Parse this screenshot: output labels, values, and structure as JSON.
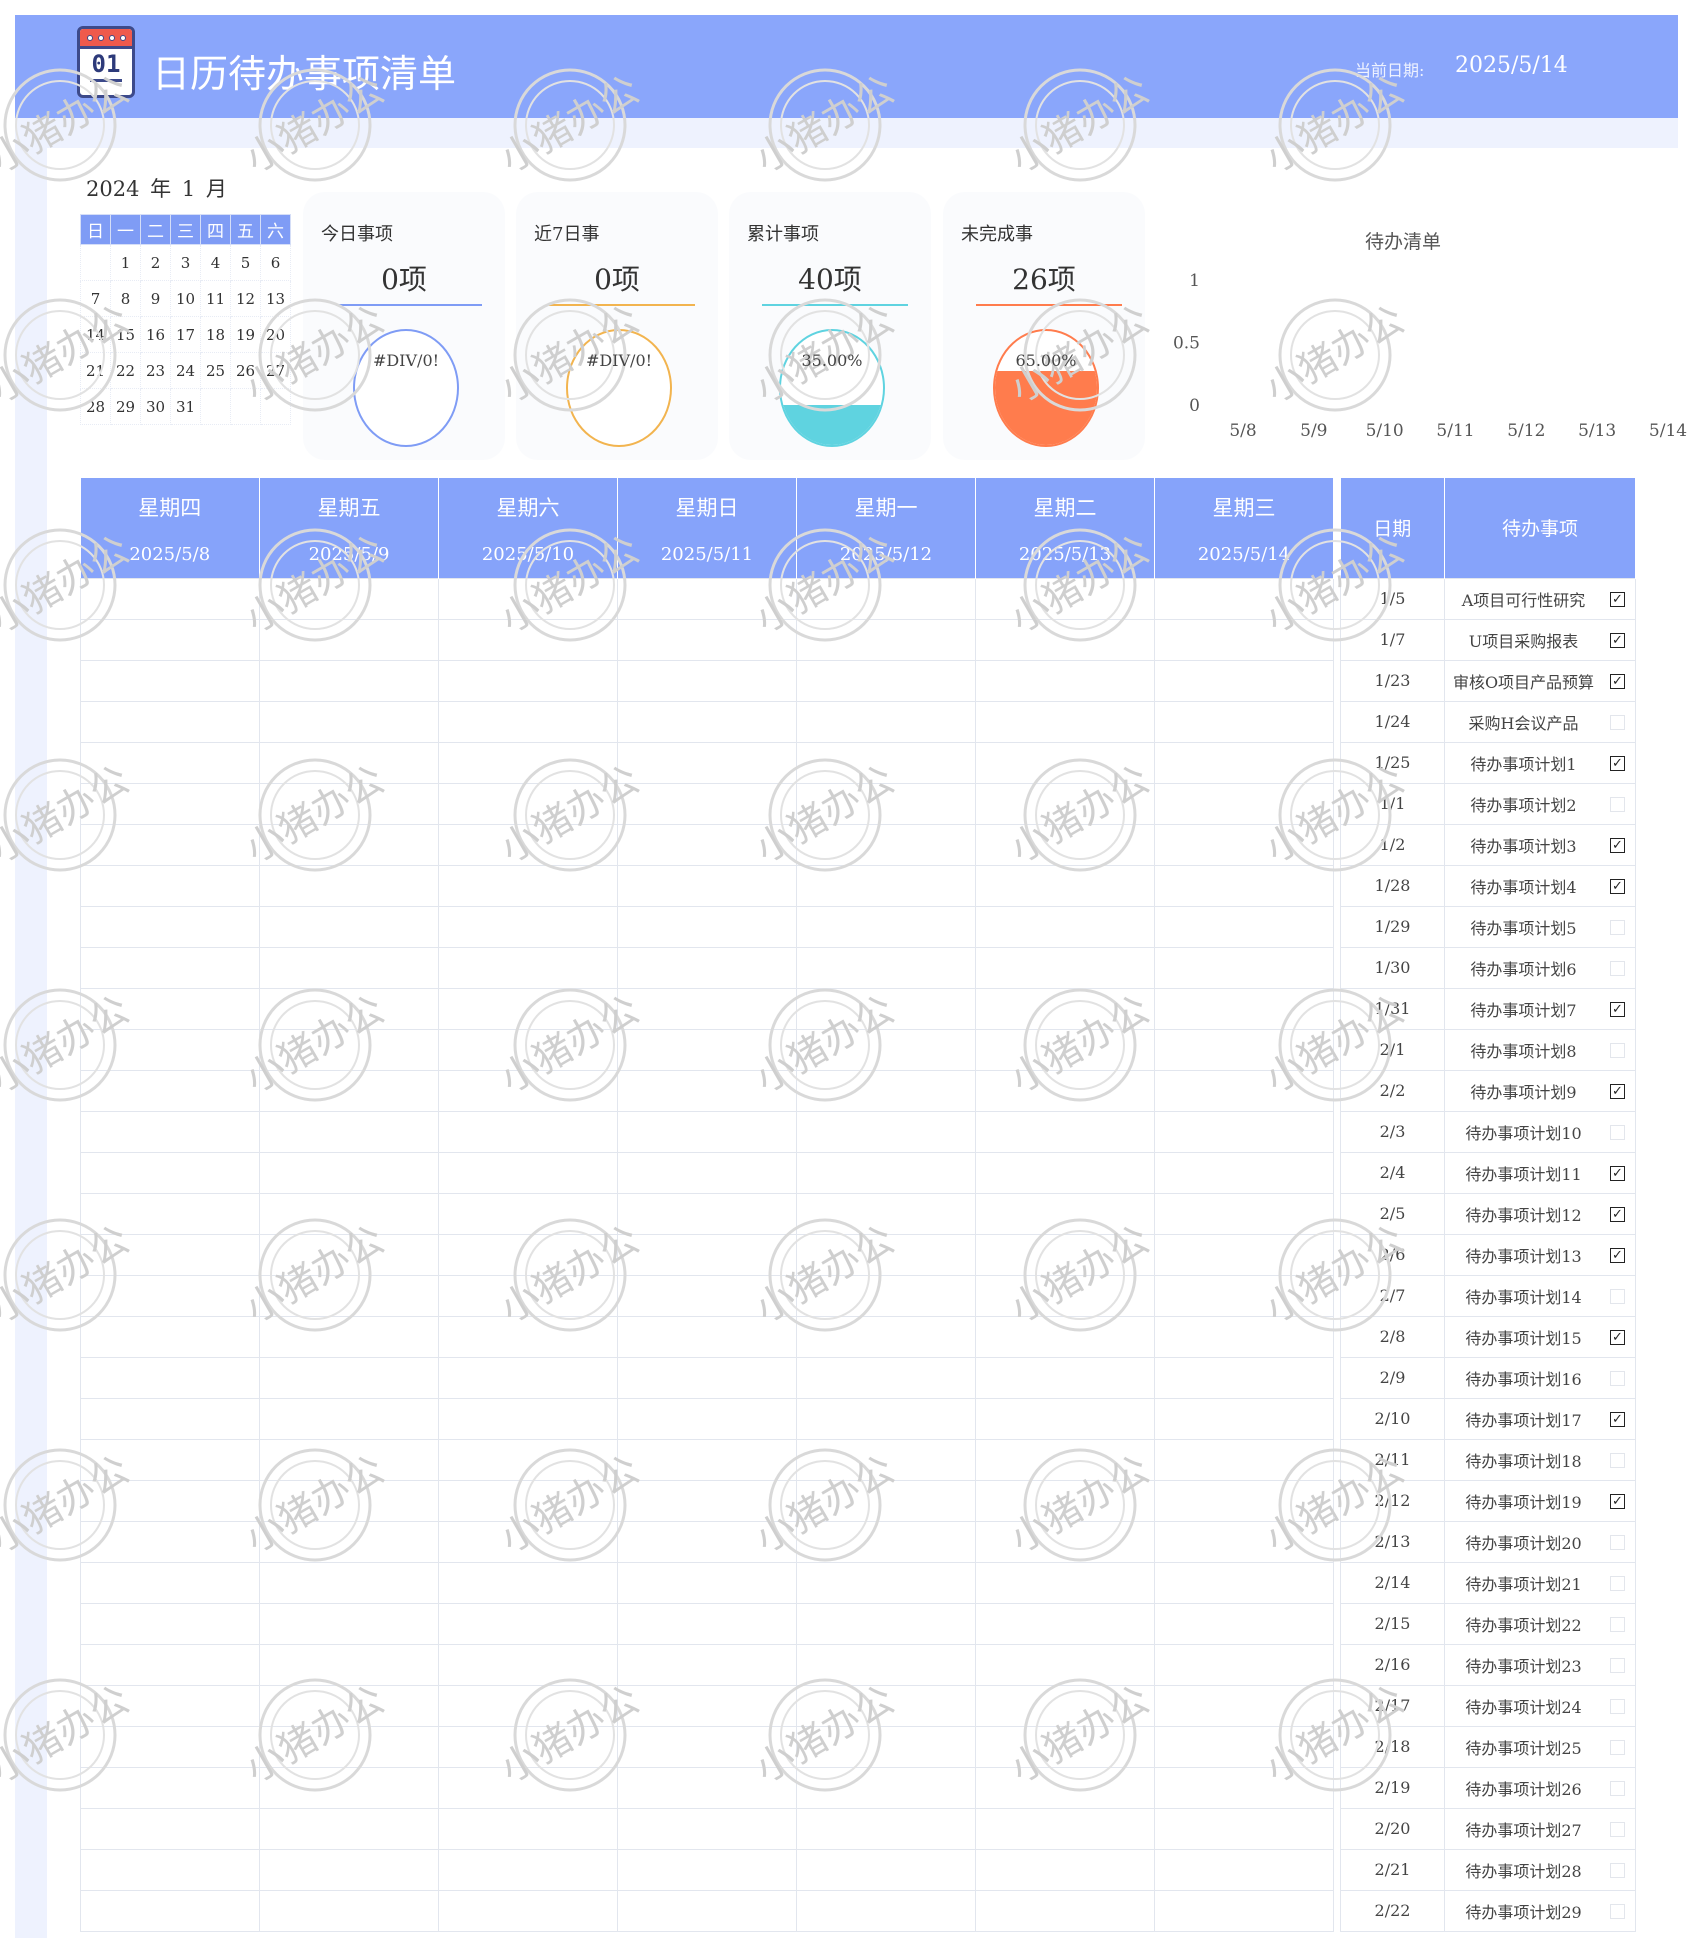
{
  "header": {
    "icon_day": "01",
    "title": "日历待办事项清单",
    "current_date_label": "当前日期:",
    "current_date": "2025/5/14",
    "brand_color": "#8aa6fb"
  },
  "mini_calendar": {
    "year": "2024",
    "year_unit": "年",
    "month": "1",
    "month_unit": "月",
    "weekdays": [
      "日",
      "一",
      "二",
      "三",
      "四",
      "五",
      "六"
    ],
    "weeks": [
      [
        "",
        "1",
        "2",
        "3",
        "4",
        "5",
        "6"
      ],
      [
        "7",
        "8",
        "9",
        "10",
        "11",
        "12",
        "13"
      ],
      [
        "14",
        "15",
        "16",
        "17",
        "18",
        "19",
        "20"
      ],
      [
        "21",
        "22",
        "23",
        "24",
        "25",
        "26",
        "27"
      ],
      [
        "28",
        "29",
        "30",
        "31",
        "",
        "",
        ""
      ]
    ]
  },
  "stats": [
    {
      "label": "今日事项",
      "value": "0项",
      "percent_text": "#DIV/0!",
      "fill": 0,
      "color": "#7f9cf5"
    },
    {
      "label": "近7日事",
      "value": "0项",
      "percent_text": "#DIV/0!",
      "fill": 0,
      "color": "#f2b44f"
    },
    {
      "label": "累计事项",
      "value": "40项",
      "percent_text": "35.00%",
      "fill": 0.35,
      "color": "#5fd3e0"
    },
    {
      "label": "未完成事",
      "value": "26项",
      "percent_text": "65.00%",
      "fill": 0.65,
      "color": "#ff7c4d"
    }
  ],
  "chart_data": {
    "type": "bar",
    "title": "待办清单",
    "categories": [
      "5/8",
      "5/9",
      "5/10",
      "5/11",
      "5/12",
      "5/13",
      "5/14"
    ],
    "values": [
      0,
      0,
      0,
      0,
      0,
      0,
      0
    ],
    "y_ticks": [
      "1",
      "0.5",
      "0"
    ],
    "ylim": [
      0,
      1
    ],
    "grid": false
  },
  "week_table": {
    "columns": [
      {
        "weekday": "星期四",
        "date": "2025/5/8"
      },
      {
        "weekday": "星期五",
        "date": "2025/5/9"
      },
      {
        "weekday": "星期六",
        "date": "2025/5/10"
      },
      {
        "weekday": "星期日",
        "date": "2025/5/11"
      },
      {
        "weekday": "星期一",
        "date": "2025/5/12"
      },
      {
        "weekday": "星期二",
        "date": "2025/5/13"
      },
      {
        "weekday": "星期三",
        "date": "2025/5/14"
      }
    ]
  },
  "todo_table": {
    "headers": {
      "date": "日期",
      "item": "待办事项"
    },
    "check_mark": "✓",
    "rows": [
      {
        "date": "1/5",
        "item": "A项目可行性研究",
        "done": true
      },
      {
        "date": "1/7",
        "item": "U项目采购报表",
        "done": true
      },
      {
        "date": "1/23",
        "item": "审核O项目产品预算",
        "done": true
      },
      {
        "date": "1/24",
        "item": "采购H会议产品",
        "done": false
      },
      {
        "date": "1/25",
        "item": "待办事项计划1",
        "done": true
      },
      {
        "date": "1/1",
        "item": "待办事项计划2",
        "done": false
      },
      {
        "date": "1/2",
        "item": "待办事项计划3",
        "done": true
      },
      {
        "date": "1/28",
        "item": "待办事项计划4",
        "done": true
      },
      {
        "date": "1/29",
        "item": "待办事项计划5",
        "done": false
      },
      {
        "date": "1/30",
        "item": "待办事项计划6",
        "done": false
      },
      {
        "date": "1/31",
        "item": "待办事项计划7",
        "done": true
      },
      {
        "date": "2/1",
        "item": "待办事项计划8",
        "done": false
      },
      {
        "date": "2/2",
        "item": "待办事项计划9",
        "done": true
      },
      {
        "date": "2/3",
        "item": "待办事项计划10",
        "done": false
      },
      {
        "date": "2/4",
        "item": "待办事项计划11",
        "done": true
      },
      {
        "date": "2/5",
        "item": "待办事项计划12",
        "done": true
      },
      {
        "date": "2/6",
        "item": "待办事项计划13",
        "done": true
      },
      {
        "date": "2/7",
        "item": "待办事项计划14",
        "done": false
      },
      {
        "date": "2/8",
        "item": "待办事项计划15",
        "done": true
      },
      {
        "date": "2/9",
        "item": "待办事项计划16",
        "done": false
      },
      {
        "date": "2/10",
        "item": "待办事项计划17",
        "done": true
      },
      {
        "date": "2/11",
        "item": "待办事项计划18",
        "done": false
      },
      {
        "date": "2/12",
        "item": "待办事项计划19",
        "done": true
      },
      {
        "date": "2/13",
        "item": "待办事项计划20",
        "done": false
      },
      {
        "date": "2/14",
        "item": "待办事项计划21",
        "done": false
      },
      {
        "date": "2/15",
        "item": "待办事项计划22",
        "done": false
      },
      {
        "date": "2/16",
        "item": "待办事项计划23",
        "done": false
      },
      {
        "date": "2/17",
        "item": "待办事项计划24",
        "done": false
      },
      {
        "date": "2/18",
        "item": "待办事项计划25",
        "done": false
      },
      {
        "date": "2/19",
        "item": "待办事项计划26",
        "done": false
      },
      {
        "date": "2/20",
        "item": "待办事项计划27",
        "done": false
      },
      {
        "date": "2/21",
        "item": "待办事项计划28",
        "done": false
      },
      {
        "date": "2/22",
        "item": "待办事项计划29",
        "done": false
      }
    ]
  },
  "watermark": {
    "text": "小猪办公"
  }
}
